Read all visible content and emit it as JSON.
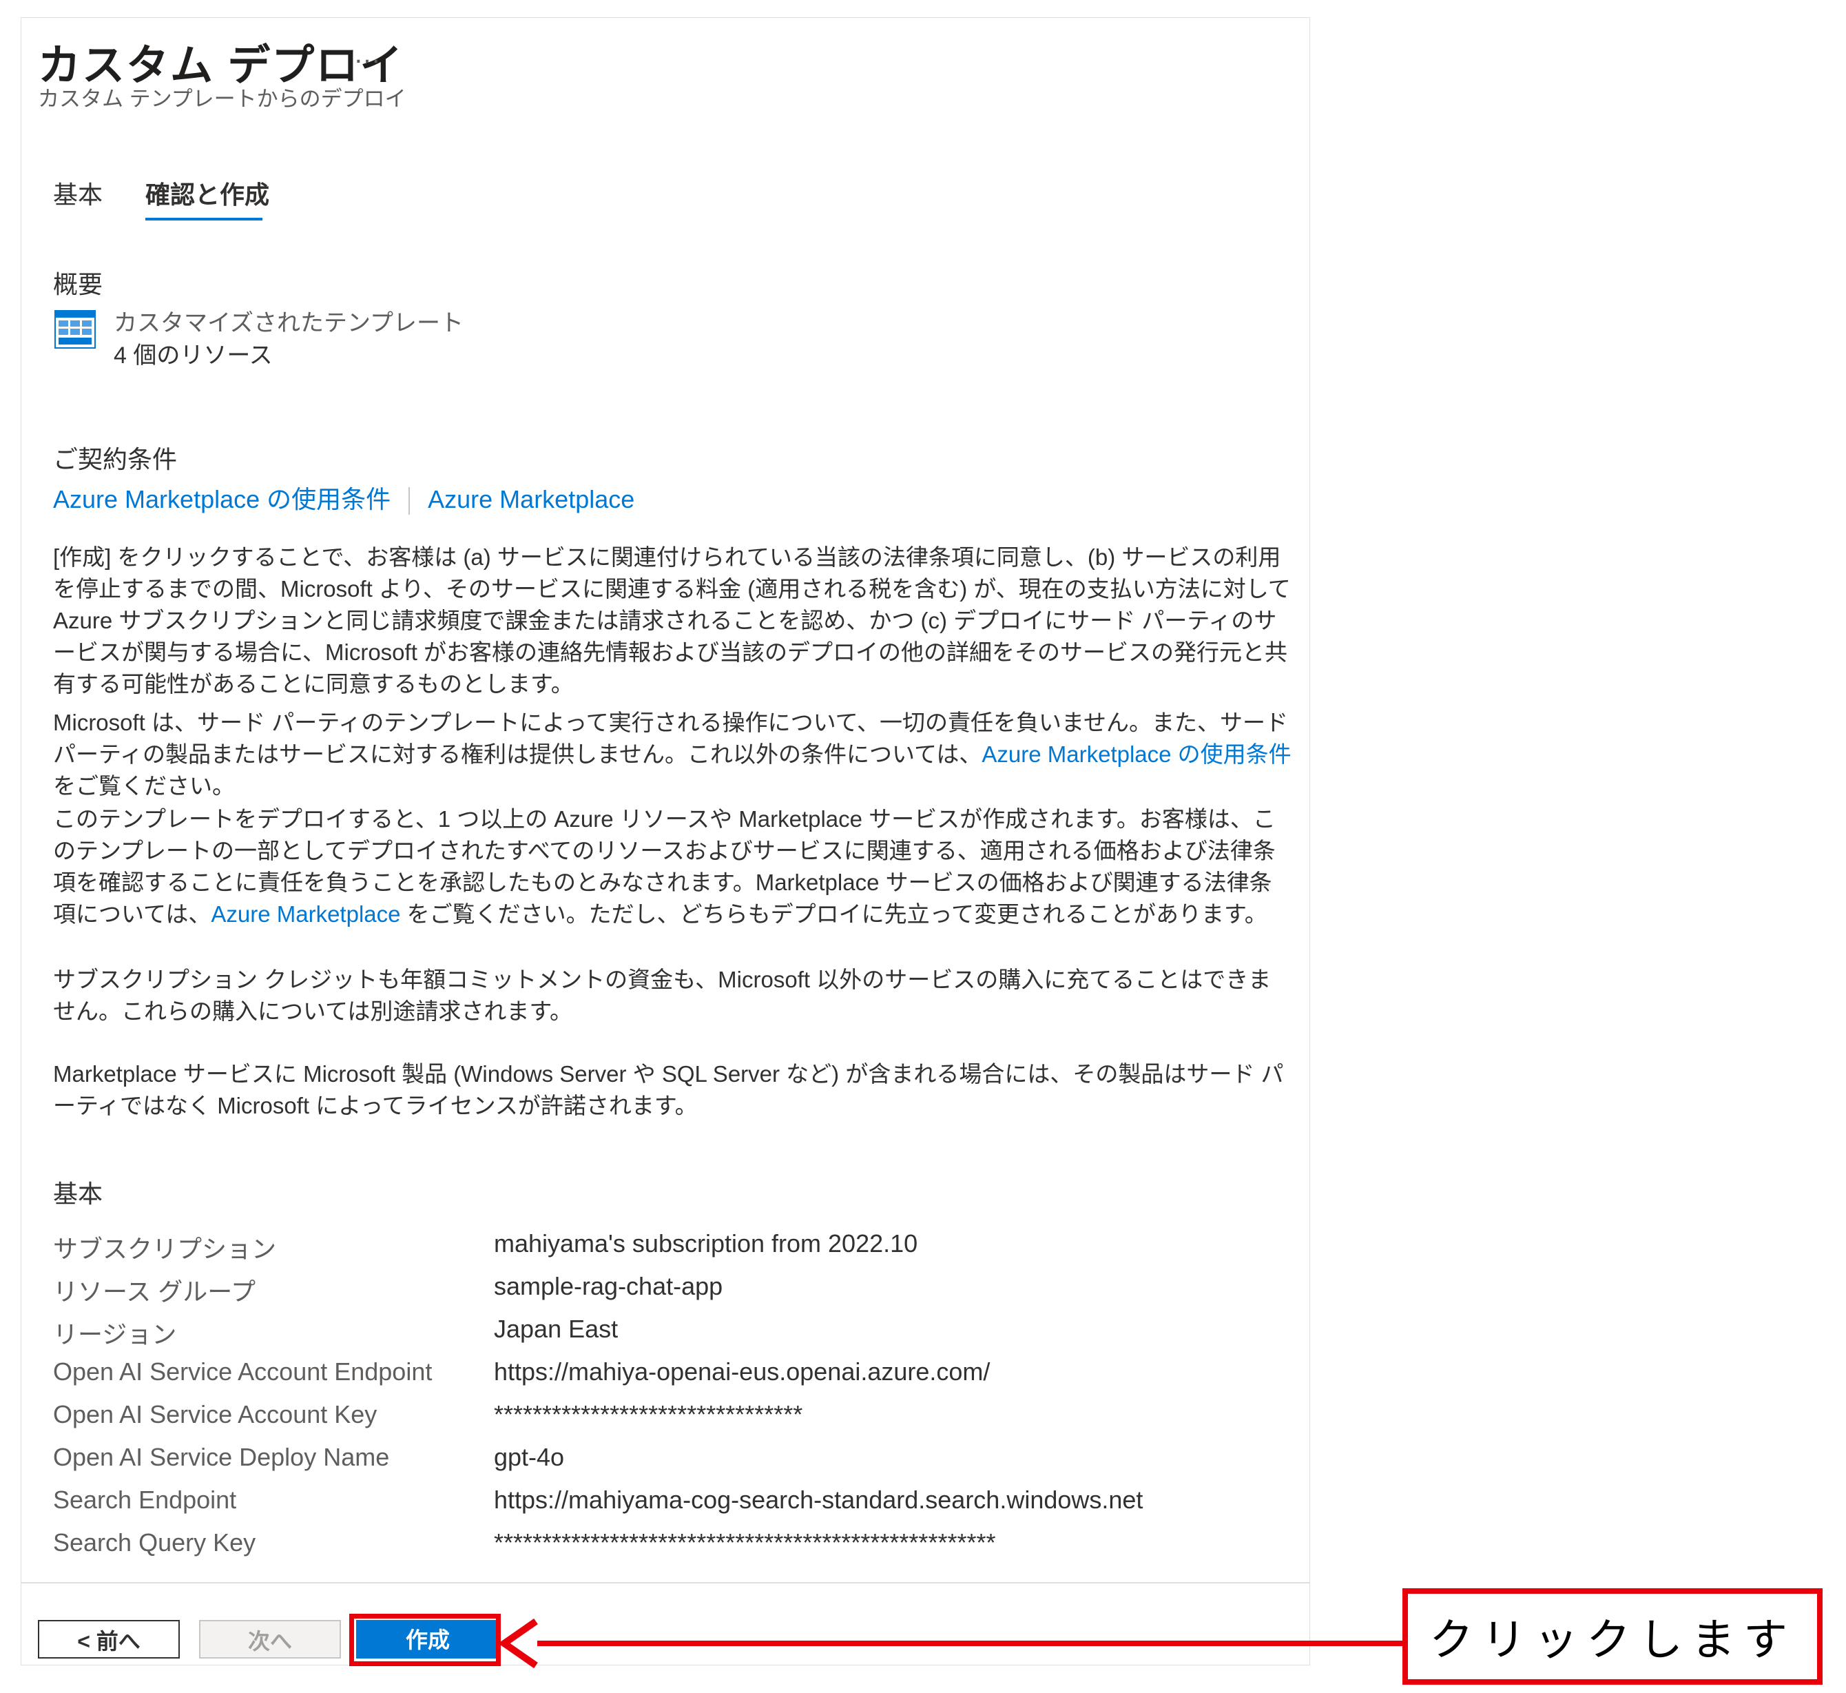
{
  "header": {
    "title": "カスタム デプロイ",
    "more": "…",
    "subtitle": "カスタム テンプレートからのデプロイ"
  },
  "tabs": [
    "基本",
    "確認と作成"
  ],
  "summary": {
    "heading": "概要",
    "line1": "カスタマイズされたテンプレート",
    "line2": "4 個のリソース"
  },
  "terms": {
    "heading": "ご契約条件",
    "link1": "Azure Marketplace の使用条件",
    "link2": "Azure Marketplace",
    "p1": "[作成] をクリックすることで、お客様は (a) サービスに関連付けられている当該の法律条項に同意し、(b) サービスの利用を停止するまでの間、Microsoft より、そのサービスに関連する料金 (適用される税を含む) が、現在の支払い方法に対して Azure サブスクリプションと同じ請求頻度で課金または請求されることを認め、かつ (c) デプロイにサード パーティのサービスが関与する場合に、Microsoft がお客様の連絡先情報および当該のデプロイの他の詳細をそのサービスの発行元と共有する可能性があることに同意するものとします。",
    "p2_pre": "Microsoft は、サード パーティのテンプレートによって実行される操作について、一切の責任を負いません。また、サード パーティの製品またはサービスに対する権利は提供しません。これ以外の条件については、",
    "p2_link": "Azure Marketplace の使用条件",
    "p2_post": " をご覧ください。",
    "p3_pre": "このテンプレートをデプロイすると、1 つ以上の Azure リソースや Marketplace サービスが作成されます。お客様は、このテンプレートの一部としてデプロイされたすべてのリソースおよびサービスに関連する、適用される価格および法律条項を確認することに責任を負うことを承認したものとみなされます。Marketplace サービスの価格および関連する法律条項については、",
    "p3_link": "Azure Marketplace",
    "p3_post": " をご覧ください。ただし、どちらもデプロイに先立って変更されることがあります。",
    "p4": "サブスクリプション クレジットも年額コミットメントの資金も、Microsoft 以外のサービスの購入に充てることはできません。これらの購入については別途請求されます。",
    "p5": "Marketplace サービスに Microsoft 製品 (Windows Server や SQL Server など) が含まれる場合には、その製品はサード パーティではなく Microsoft によってライセンスが許諾されます。"
  },
  "basics": {
    "heading": "基本",
    "rows": [
      {
        "label": "サブスクリプション",
        "value": "mahiyama's subscription from 2022.10"
      },
      {
        "label": "リソース グループ",
        "value": "sample-rag-chat-app"
      },
      {
        "label": "リージョン",
        "value": "Japan East"
      },
      {
        "label": "Open AI Service Account Endpoint",
        "value": "https://mahiya-openai-eus.openai.azure.com/"
      },
      {
        "label": "Open AI Service Account Key",
        "value": "********************************"
      },
      {
        "label": "Open AI Service Deploy Name",
        "value": "gpt-4o"
      },
      {
        "label": "Search Endpoint",
        "value": "https://mahiyama-cog-search-standard.search.windows.net"
      },
      {
        "label": "Search Query Key",
        "value": "****************************************************"
      }
    ]
  },
  "footer": {
    "prev": "< 前へ",
    "next": "次へ",
    "create": "作成"
  },
  "annotation": {
    "callout": "クリックします",
    "color": "#e8000b"
  },
  "colors": {
    "accent": "#0078d4",
    "text": "#323130",
    "muted": "#605e5c"
  }
}
